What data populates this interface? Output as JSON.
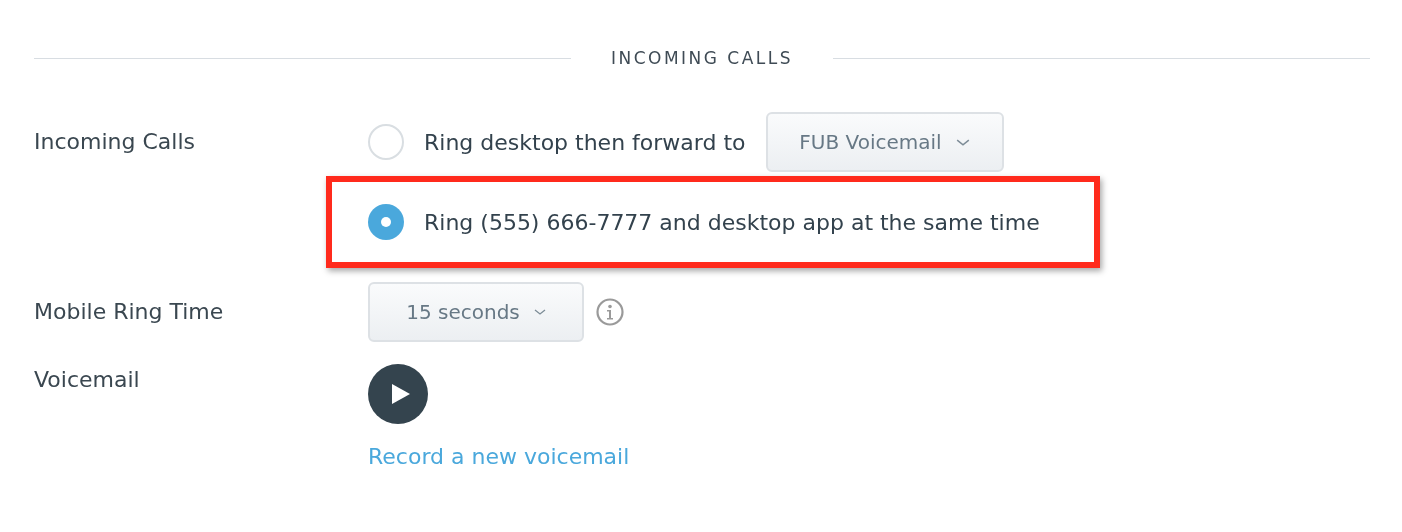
{
  "section": {
    "title": "INCOMING CALLS"
  },
  "incoming_calls": {
    "label": "Incoming Calls",
    "options": [
      {
        "kind": "forward",
        "text": "Ring desktop then forward to",
        "selected": false,
        "highlighted": false,
        "dropdown": "FUB Voicemail"
      },
      {
        "kind": "plain",
        "text": "Ring (555) 666-7777 and desktop app at the same time",
        "selected": true,
        "highlighted": true
      }
    ]
  },
  "mobile_ring_time": {
    "label": "Mobile Ring Time",
    "dropdown": "15 seconds"
  },
  "voicemail": {
    "label": "Voicemail",
    "link": "Record a new voicemail"
  }
}
